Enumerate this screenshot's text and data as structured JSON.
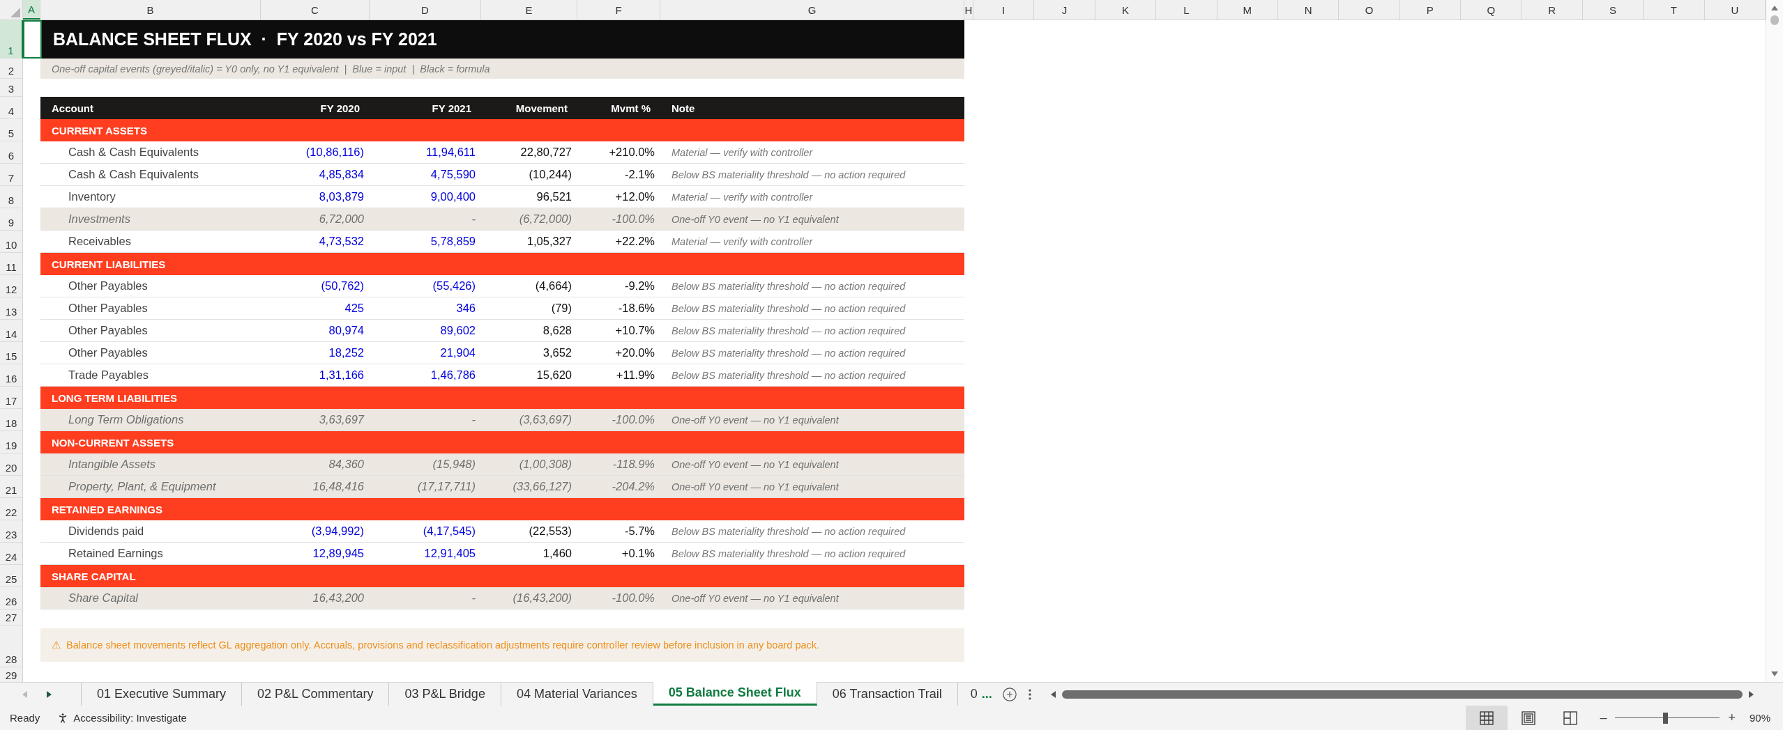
{
  "columns": [
    {
      "label": "A",
      "selected": true
    },
    {
      "label": "B",
      "selected": false
    },
    {
      "label": "C",
      "selected": false
    },
    {
      "label": "D",
      "selected": false
    },
    {
      "label": "E",
      "selected": false
    },
    {
      "label": "F",
      "selected": false
    },
    {
      "label": "G",
      "selected": false
    },
    {
      "label": "H",
      "selected": false
    },
    {
      "label": "I",
      "selected": false
    },
    {
      "label": "J",
      "selected": false
    },
    {
      "label": "K",
      "selected": false
    },
    {
      "label": "L",
      "selected": false
    },
    {
      "label": "M",
      "selected": false
    },
    {
      "label": "N",
      "selected": false
    },
    {
      "label": "O",
      "selected": false
    },
    {
      "label": "P",
      "selected": false
    },
    {
      "label": "Q",
      "selected": false
    },
    {
      "label": "R",
      "selected": false
    },
    {
      "label": "S",
      "selected": false
    },
    {
      "label": "T",
      "selected": false
    },
    {
      "label": "U",
      "selected": false
    }
  ],
  "sheet_rows": [
    {
      "number": "1",
      "selected": true,
      "kind": "title",
      "text": "BALANCE SHEET FLUX  ·  FY 2020 vs FY 2021"
    },
    {
      "number": "2",
      "selected": false,
      "kind": "legend",
      "text": "One-off capital events (greyed/italic) = Y0 only, no Y1 equivalent  |  Blue = input  |  Black = formula"
    },
    {
      "number": "3",
      "selected": false,
      "kind": "blank"
    },
    {
      "number": "4",
      "selected": false,
      "kind": "header",
      "cells": [
        "Account",
        "FY 2020",
        "FY 2021",
        "Movement",
        "Mvmt %",
        "Note"
      ]
    },
    {
      "number": "5",
      "selected": false,
      "kind": "section",
      "text": "CURRENT ASSETS"
    },
    {
      "number": "6",
      "selected": false,
      "kind": "input",
      "cells": [
        "Cash & Cash Equivalents",
        "(10,86,116)",
        "11,94,611",
        "22,80,727",
        "+210.0%",
        "Material — verify with controller"
      ]
    },
    {
      "number": "7",
      "selected": false,
      "kind": "input",
      "cells": [
        "Cash & Cash Equivalents",
        "4,85,834",
        "4,75,590",
        "(10,244)",
        "-2.1%",
        "Below BS materiality threshold — no action required"
      ]
    },
    {
      "number": "8",
      "selected": false,
      "kind": "input",
      "cells": [
        "Inventory",
        "8,03,879",
        "9,00,400",
        "96,521",
        "+12.0%",
        "Material — verify with controller"
      ]
    },
    {
      "number": "9",
      "selected": false,
      "kind": "oneoff",
      "cells": [
        "Investments",
        "6,72,000",
        "-",
        "(6,72,000)",
        "-100.0%",
        "One-off Y0 event — no Y1 equivalent"
      ]
    },
    {
      "number": "10",
      "selected": false,
      "kind": "input",
      "cells": [
        "Receivables",
        "4,73,532",
        "5,78,859",
        "1,05,327",
        "+22.2%",
        "Material — verify with controller"
      ]
    },
    {
      "number": "11",
      "selected": false,
      "kind": "section",
      "text": "CURRENT LIABILITIES"
    },
    {
      "number": "12",
      "selected": false,
      "kind": "input",
      "cells": [
        "Other Payables",
        "(50,762)",
        "(55,426)",
        "(4,664)",
        "-9.2%",
        "Below BS materiality threshold — no action required"
      ]
    },
    {
      "number": "13",
      "selected": false,
      "kind": "input",
      "cells": [
        "Other Payables",
        "425",
        "346",
        "(79)",
        "-18.6%",
        "Below BS materiality threshold — no action required"
      ]
    },
    {
      "number": "14",
      "selected": false,
      "kind": "input",
      "cells": [
        "Other Payables",
        "80,974",
        "89,602",
        "8,628",
        "+10.7%",
        "Below BS materiality threshold — no action required"
      ]
    },
    {
      "number": "15",
      "selected": false,
      "kind": "input",
      "cells": [
        "Other Payables",
        "18,252",
        "21,904",
        "3,652",
        "+20.0%",
        "Below BS materiality threshold — no action required"
      ]
    },
    {
      "number": "16",
      "selected": false,
      "kind": "input",
      "cells": [
        "Trade Payables",
        "1,31,166",
        "1,46,786",
        "15,620",
        "+11.9%",
        "Below BS materiality threshold — no action required"
      ]
    },
    {
      "number": "17",
      "selected": false,
      "kind": "section",
      "text": "LONG TERM LIABILITIES"
    },
    {
      "number": "18",
      "selected": false,
      "kind": "oneoff",
      "cells": [
        "Long Term Obligations",
        "3,63,697",
        "-",
        "(3,63,697)",
        "-100.0%",
        "One-off Y0 event — no Y1 equivalent"
      ]
    },
    {
      "number": "19",
      "selected": false,
      "kind": "section",
      "text": "NON-CURRENT ASSETS"
    },
    {
      "number": "20",
      "selected": false,
      "kind": "oneoff",
      "cells": [
        "Intangible Assets",
        "84,360",
        "(15,948)",
        "(1,00,308)",
        "-118.9%",
        "One-off Y0 event — no Y1 equivalent"
      ]
    },
    {
      "number": "21",
      "selected": false,
      "kind": "oneoff",
      "cells": [
        "Property, Plant, & Equipment",
        "16,48,416",
        "(17,17,711)",
        "(33,66,127)",
        "-204.2%",
        "One-off Y0 event — no Y1 equivalent"
      ]
    },
    {
      "number": "22",
      "selected": false,
      "kind": "section",
      "text": "RETAINED EARNINGS"
    },
    {
      "number": "23",
      "selected": false,
      "kind": "input",
      "cells": [
        "Dividends paid",
        "(3,94,992)",
        "(4,17,545)",
        "(22,553)",
        "-5.7%",
        "Below BS materiality threshold — no action required"
      ]
    },
    {
      "number": "24",
      "selected": false,
      "kind": "input",
      "cells": [
        "Retained Earnings",
        "12,89,945",
        "12,91,405",
        "1,460",
        "+0.1%",
        "Below BS materiality threshold — no action required"
      ]
    },
    {
      "number": "25",
      "selected": false,
      "kind": "section",
      "text": "SHARE CAPITAL"
    },
    {
      "number": "26",
      "selected": false,
      "kind": "oneoff",
      "cells": [
        "Share Capital",
        "16,43,200",
        "-",
        "(16,43,200)",
        "-100.0%",
        "One-off Y0 event — no Y1 equivalent"
      ]
    },
    {
      "number": "27",
      "selected": false,
      "kind": "blank"
    },
    {
      "number": "28",
      "selected": false,
      "kind": "footnote",
      "text": "⚠  Balance sheet movements reflect GL aggregation only. Accruals, provisions and reclassification adjustments require controller review before inclusion in any board pack."
    },
    {
      "number": "29",
      "selected": false,
      "kind": "blank"
    }
  ],
  "sheet_tabs": [
    {
      "label": "01 Executive Summary",
      "selected": false
    },
    {
      "label": "02 P&L Commentary",
      "selected": false
    },
    {
      "label": "03 P&L Bridge",
      "selected": false
    },
    {
      "label": "04 Material Variances",
      "selected": false
    },
    {
      "label": "05 Balance Sheet Flux",
      "selected": true
    },
    {
      "label": "06 Transaction Trail",
      "selected": false
    },
    {
      "label": "0",
      "selected": false
    }
  ],
  "more_tabs": "...",
  "status_bar": {
    "mode": "Ready",
    "accessibility": "Accessibility: Investigate",
    "views": [
      {
        "kind": "normal",
        "selected": true
      },
      {
        "kind": "page_layout",
        "selected": false
      },
      {
        "kind": "page_break",
        "selected": false
      }
    ],
    "zoom_out": "–",
    "zoom_in": "+",
    "zoom": {
      "level": 0.48
    },
    "zoom_text": "90%"
  }
}
